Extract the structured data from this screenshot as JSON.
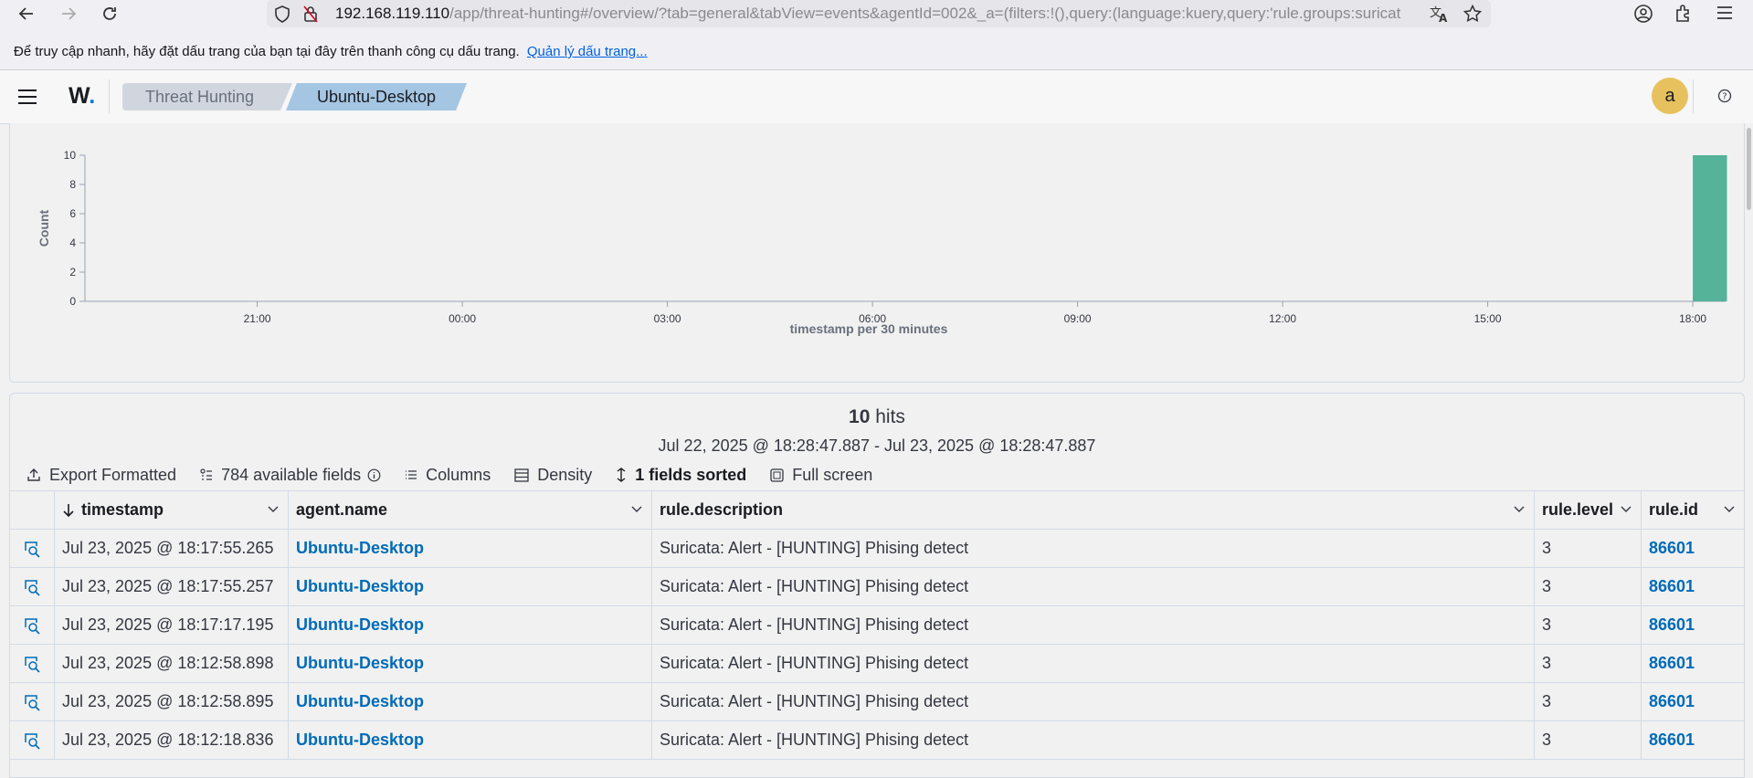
{
  "browser": {
    "url_host": "192.168.119.110",
    "url_path": "/app/threat-hunting#/overview/?tab=general&tabView=events&agentId=002&_a=(filters:!(),query:(language:kuery,query:'rule.groups:suricat",
    "bookmark_hint": "Để truy cập nhanh, hãy đặt dấu trang của bạn tại đây trên thanh công cụ dấu trang.",
    "bookmark_link": "Quản lý dấu trang..."
  },
  "header": {
    "logo": "W",
    "breadcrumbs": [
      "Threat Hunting",
      "Ubuntu-Desktop"
    ],
    "avatar_initial": "a"
  },
  "chart_data": {
    "type": "bar",
    "xlabel": "timestamp per 30 minutes",
    "ylabel": "Count",
    "ylim": [
      0,
      10
    ],
    "yticks": [
      0,
      2,
      4,
      6,
      8,
      10
    ],
    "xticks": [
      "21:00",
      "00:00",
      "03:00",
      "06:00",
      "09:00",
      "12:00",
      "15:00",
      "18:00"
    ],
    "x_range_hours": [
      18.48,
      42.48
    ],
    "bars": [
      {
        "x_hours": 42.0,
        "width_hours": 0.5,
        "value": 10
      }
    ],
    "bar_color": "#54b399",
    "grid": false
  },
  "results": {
    "hits_count": "10",
    "hits_label": "hits",
    "date_range": "Jul 22, 2025 @ 18:28:47.887 - Jul 23, 2025 @ 18:28:47.887",
    "toolbar": {
      "export": "Export Formatted",
      "fields": "784 available fields",
      "columns": "Columns",
      "density": "Density",
      "sorted": "1 fields sorted",
      "fullscreen": "Full screen"
    },
    "columns": [
      "timestamp",
      "agent.name",
      "rule.description",
      "rule.level",
      "rule.id"
    ],
    "rows": [
      [
        "Jul 23, 2025 @ 18:17:55.265",
        "Ubuntu-Desktop",
        "Suricata: Alert - [HUNTING] Phising detect",
        "3",
        "86601"
      ],
      [
        "Jul 23, 2025 @ 18:17:55.257",
        "Ubuntu-Desktop",
        "Suricata: Alert - [HUNTING] Phising detect",
        "3",
        "86601"
      ],
      [
        "Jul 23, 2025 @ 18:17:17.195",
        "Ubuntu-Desktop",
        "Suricata: Alert - [HUNTING] Phising detect",
        "3",
        "86601"
      ],
      [
        "Jul 23, 2025 @ 18:12:58.898",
        "Ubuntu-Desktop",
        "Suricata: Alert - [HUNTING] Phising detect",
        "3",
        "86601"
      ],
      [
        "Jul 23, 2025 @ 18:12:58.895",
        "Ubuntu-Desktop",
        "Suricata: Alert - [HUNTING] Phising detect",
        "3",
        "86601"
      ],
      [
        "Jul 23, 2025 @ 18:12:18.836",
        "Ubuntu-Desktop",
        "Suricata: Alert - [HUNTING] Phising detect",
        "3",
        "86601"
      ]
    ]
  }
}
